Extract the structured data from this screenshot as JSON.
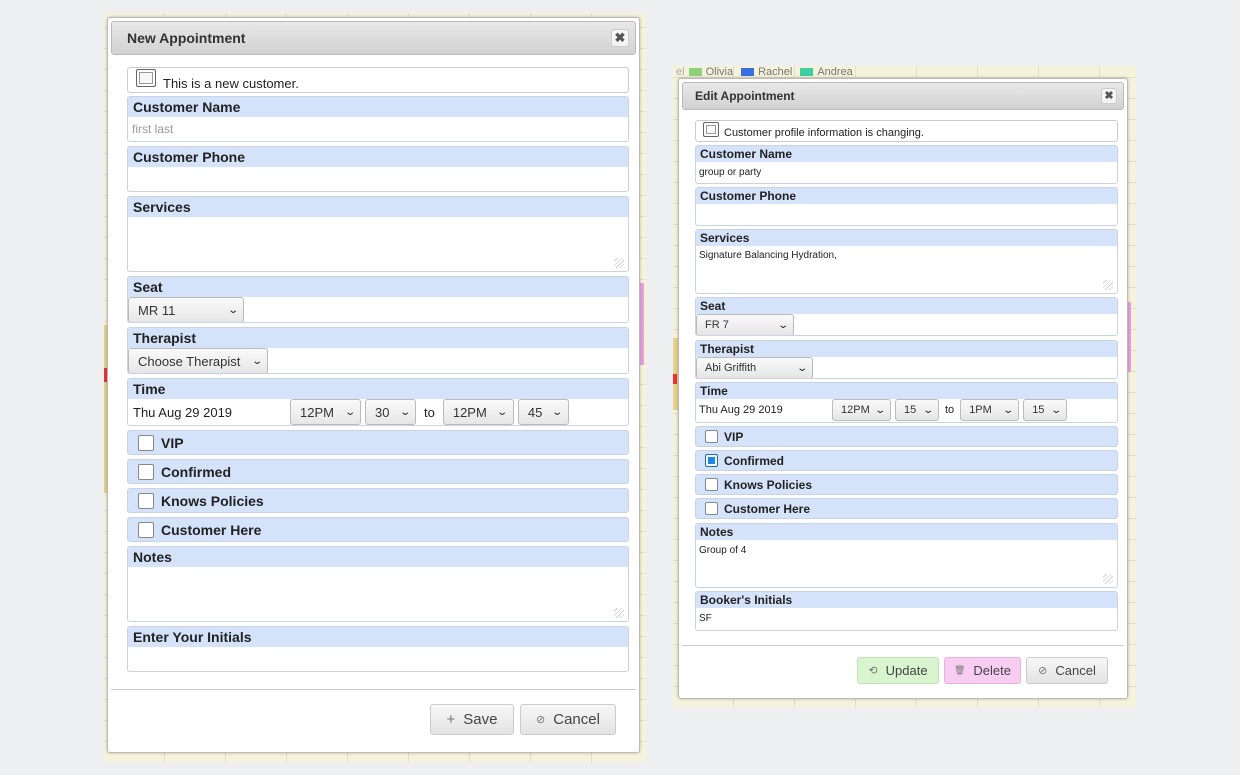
{
  "legend": {
    "items": [
      {
        "name": "Olivia",
        "color": "#8fd07a"
      },
      {
        "name": "Rachel",
        "color": "#3b6fe0"
      },
      {
        "name": "Andrea",
        "color": "#3ccfa0"
      }
    ]
  },
  "new_dialog": {
    "title": "New Appointment",
    "close_glyph": "✖",
    "new_customer_label": "This is a new customer.",
    "customer_name": {
      "label": "Customer Name",
      "placeholder": "first last",
      "value": ""
    },
    "customer_phone": {
      "label": "Customer Phone",
      "value": ""
    },
    "services": {
      "label": "Services",
      "value": ""
    },
    "seat": {
      "label": "Seat",
      "value": "MR 11"
    },
    "therapist": {
      "label": "Therapist",
      "value": "Choose Therapist"
    },
    "time": {
      "label": "Time",
      "date": "Thu Aug 29 2019",
      "start_hour": "12PM",
      "start_min": "30",
      "to": "to",
      "end_hour": "12PM",
      "end_min": "45"
    },
    "checks": [
      {
        "label": "VIP",
        "checked": false
      },
      {
        "label": "Confirmed",
        "checked": false
      },
      {
        "label": "Knows Policies",
        "checked": false
      },
      {
        "label": "Customer Here",
        "checked": false
      }
    ],
    "notes": {
      "label": "Notes",
      "value": ""
    },
    "initials": {
      "label": "Enter Your Initials",
      "value": ""
    },
    "buttons": {
      "save": "Save",
      "save_icon": "+",
      "cancel": "Cancel",
      "cancel_icon": "⊘"
    }
  },
  "edit_dialog": {
    "title": "Edit Appointment",
    "close_glyph": "✖",
    "profile_label": "Customer profile information is changing.",
    "customer_name": {
      "label": "Customer Name",
      "value": "group or party"
    },
    "customer_phone": {
      "label": "Customer Phone",
      "value": ""
    },
    "services": {
      "label": "Services",
      "value": "Signature Balancing Hydration,"
    },
    "seat": {
      "label": "Seat",
      "value": "FR 7"
    },
    "therapist": {
      "label": "Therapist",
      "value": "Abi Griffith"
    },
    "time": {
      "label": "Time",
      "date": "Thu Aug 29 2019",
      "start_hour": "12PM",
      "start_min": "15",
      "to": "to",
      "end_hour": "1PM",
      "end_min": "15"
    },
    "checks": [
      {
        "label": "VIP",
        "checked": false
      },
      {
        "label": "Confirmed",
        "checked": true
      },
      {
        "label": "Knows Policies",
        "checked": false
      },
      {
        "label": "Customer Here",
        "checked": false
      }
    ],
    "notes": {
      "label": "Notes",
      "value": "Group of 4"
    },
    "initials": {
      "label": "Booker's Initials",
      "value": "SF"
    },
    "buttons": {
      "update": "Update",
      "update_icon": "⟲",
      "update_color": "#d8f5cf",
      "delete": "Delete",
      "delete_icon": "🗑",
      "delete_color": "#f7cdf2",
      "cancel": "Cancel",
      "cancel_icon": "⊘"
    }
  }
}
